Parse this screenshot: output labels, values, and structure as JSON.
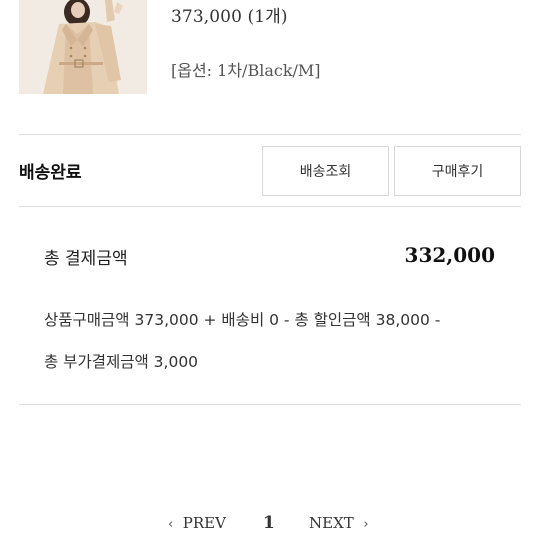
{
  "order_item": {
    "image_icon": "coat-product-photo",
    "price_qty": "373,000 (1개)",
    "option": "[옵션: 1차/Black/M]"
  },
  "delivery": {
    "status": "배송완료",
    "track_button": "배송조회",
    "review_button": "구매후기"
  },
  "payment": {
    "total_label": "총 결제금액",
    "total_value": "332,000",
    "breakdown_line1": "상품구매금액 373,000 + 배송비 0 - 총 할인금액 38,000 -",
    "breakdown_line2": "총 부가결제금액 3,000"
  },
  "pagination": {
    "prev": "PREV",
    "current": "1",
    "next": "NEXT"
  }
}
